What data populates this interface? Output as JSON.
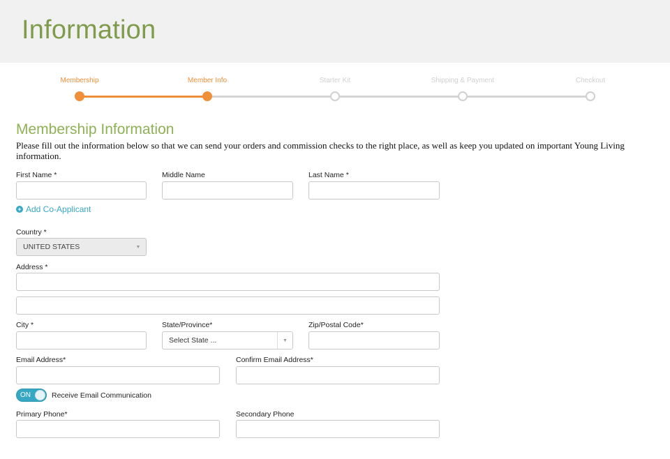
{
  "header": {
    "title": "Information"
  },
  "steps": [
    {
      "label": "Membership",
      "state": "active"
    },
    {
      "label": "Member Info",
      "state": "active"
    },
    {
      "label": "Starter Kit",
      "state": "todo"
    },
    {
      "label": "Shipping & Payment",
      "state": "todo"
    },
    {
      "label": "Checkout",
      "state": "todo"
    }
  ],
  "section": {
    "title": "Membership Information",
    "intro": "Please fill out the information below so that we can send your orders and commission checks to the right place, as well as keep you updated on important Young Living information."
  },
  "form": {
    "first_name": {
      "label": "First Name *",
      "value": ""
    },
    "middle_name": {
      "label": "Middle Name",
      "value": ""
    },
    "last_name": {
      "label": "Last Name *",
      "value": ""
    },
    "add_coapplicant": "Add Co-Applicant",
    "country": {
      "label": "Country *",
      "value": "UNITED STATES"
    },
    "address": {
      "label": "Address *",
      "line1": "",
      "line2": ""
    },
    "city": {
      "label": "City *",
      "value": ""
    },
    "state": {
      "label": "State/Province*",
      "value": "Select State ..."
    },
    "zip": {
      "label": "Zip/Postal Code*",
      "value": ""
    },
    "email": {
      "label": "Email Address*",
      "value": ""
    },
    "confirm_email": {
      "label": "Confirm Email Address*",
      "value": ""
    },
    "email_toggle": {
      "state": "ON",
      "label": "Receive Email Communication"
    },
    "primary_phone": {
      "label": "Primary Phone*",
      "value": ""
    },
    "secondary_phone": {
      "label": "Secondary Phone",
      "value": ""
    }
  },
  "colors": {
    "title_green": "#7f9b4c",
    "section_green": "#8fb155",
    "progress_orange": "#ef8f3a",
    "accent_teal": "#37a8c3"
  }
}
